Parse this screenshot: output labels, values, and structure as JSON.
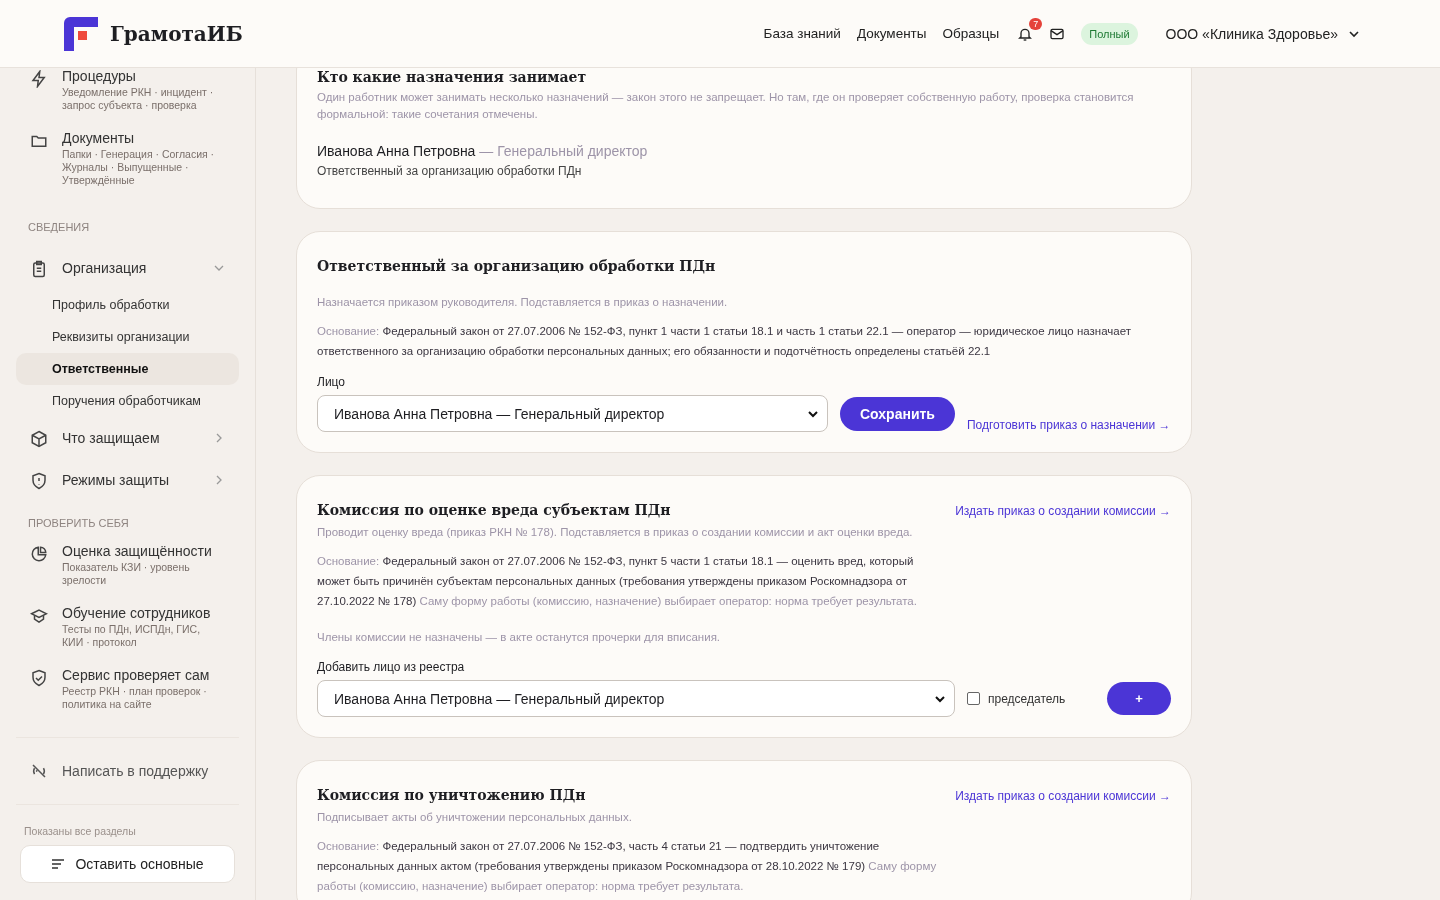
{
  "header": {
    "logo_text": "ГрамотаИБ",
    "nav": [
      "База знаний",
      "Документы",
      "Образцы"
    ],
    "notifications": "7",
    "plan_badge": "Полный",
    "organization": "ООО «Клиника Здоровье»"
  },
  "sidebar": {
    "items": [
      {
        "kind": "link",
        "title": "Процедуры",
        "subtitle": "Уведомление РКН · инцидент · запрос субъекта · проверка"
      },
      {
        "kind": "link",
        "title": "Документы",
        "subtitle": "Папки · Генерация · Согласия · Журналы · Выпущенные · Утверждённые"
      },
      {
        "kind": "section",
        "title": "СВЕДЕНИЯ"
      },
      {
        "kind": "group",
        "title": "Организация",
        "expanded": true,
        "children": [
          {
            "title": "Профиль обработки",
            "selected": false
          },
          {
            "title": "Реквизиты организации",
            "selected": false
          },
          {
            "title": "Ответственные",
            "selected": true
          },
          {
            "title": "Поручения обработчикам",
            "selected": false
          }
        ]
      },
      {
        "kind": "group",
        "title": "Что защищаем",
        "expanded": false
      },
      {
        "kind": "group",
        "title": "Режимы защиты",
        "expanded": false
      },
      {
        "kind": "section",
        "title": "ПРОВЕРИТЬ СЕБЯ"
      },
      {
        "kind": "link",
        "title": "Оценка защищённости",
        "subtitle": "Показатель КЗИ · уровень зрелости"
      },
      {
        "kind": "link",
        "title": "Обучение сотрудников",
        "subtitle": "Тесты по ПДн, ИСПДн, ГИС, КИИ · протокол"
      },
      {
        "kind": "link",
        "title": "Сервис проверяет сам",
        "subtitle": "Реестр РКН · план проверок · политика на сайте"
      }
    ],
    "support": "Написать в поддержку",
    "filter_note": "Показаны все разделы",
    "filter_button": "Оставить основные"
  },
  "cards": [
    {
      "kind": "summary",
      "title": "Кто какие назначения занимает",
      "description": "Один работник может занимать несколько назначений — закон этого не запрещает. Но там, где он проверяет собственную работу, проверка становится формальной: такие сочетания отмечены.",
      "people": [
        {
          "name": "Иванова Анна Петровна",
          "role": "— Генеральный директор",
          "duty": "Ответственный за организацию обработки ПДн"
        }
      ]
    },
    {
      "kind": "assign",
      "title": "Ответственный за организацию обработки ПДн",
      "description": "Назначается приказом руководителя. Подставляется в приказ о назначении.",
      "basis_label": "Основание:",
      "basis_text": "Федеральный закон от 27.07.2006 № 152-ФЗ, пункт 1 части 1 статьи 18.1 и часть 1 статьи 22.1 — оператор — юридическое лицо назначает ответственного за организацию обработки персональных данных; его обязанности и подотчётность определены статьёй 22.1",
      "field_label": "Лицо",
      "select_value": "Иванова Анна Петровна — Генеральный директор",
      "button": "Сохранить",
      "link": "Подготовить приказ о назначении →"
    },
    {
      "kind": "commission",
      "title": "Комиссия по оценке вреда субъектам ПДн",
      "link": "Издать приказ о создании комиссии →",
      "description": "Проводит оценку вреда (приказ РКН № 178). Подставляется в приказ о создании комиссии и акт оценки вреда.",
      "basis_label": "Основание:",
      "basis_text": "Федеральный закон от 27.07.2006 № 152-ФЗ, пункт 5 части 1 статьи 18.1 — оценить вред, который может быть причинён субъектам персональных данных (требования утверждены приказом Роскомнадзора от 27.10.2022 № 178)",
      "basis_note": "Саму форму работы (комиссию, назначение) выбирает оператор: норма требует результата.",
      "empty_note": "Члены комиссии не назначены — в акте останутся прочерки для вписания.",
      "field_label": "Добавить лицо из реестра",
      "select_value": "Иванова Анна Петровна — Генеральный директор",
      "chair_label": "председатель",
      "chair_checked": false,
      "add_button": "+"
    },
    {
      "kind": "commission",
      "title": "Комиссия по уничтожению ПДн",
      "link": "Издать приказ о создании комиссии →",
      "description": "Подписывает акты об уничтожении персональных данных.",
      "basis_label": "Основание:",
      "basis_text": "Федеральный закон от 27.07.2006 № 152-ФЗ, часть 4 статьи 21 — подтвердить уничтожение персональных данных актом (требования утверждены приказом Роскомнадзора от 28.10.2022 № 179)",
      "basis_note": "Саму форму работы (комиссию, назначение) выбирает оператор: норма требует результата."
    }
  ]
}
